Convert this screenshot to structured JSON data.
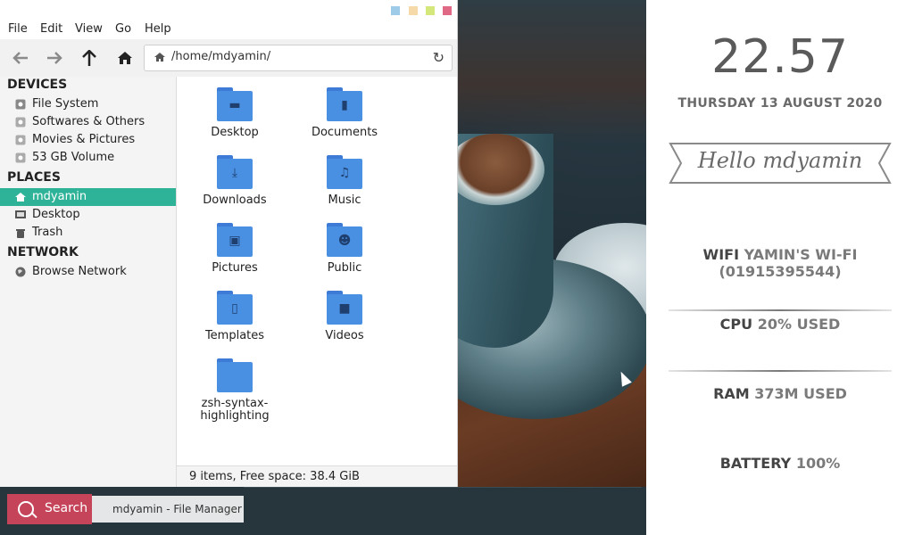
{
  "file_manager": {
    "title_buttons": [
      {
        "name": "minimize",
        "color": "#9ecbe8"
      },
      {
        "name": "maximize",
        "color": "#f5d9a8"
      },
      {
        "name": "shade",
        "color": "#d4e77a"
      },
      {
        "name": "close",
        "color": "#e06a86"
      }
    ],
    "menu": [
      "File",
      "Edit",
      "View",
      "Go",
      "Help"
    ],
    "toolbar": {
      "back_icon": "arrow-left-icon",
      "forward_icon": "arrow-right-icon",
      "up_icon": "arrow-up-icon",
      "home_icon": "home-icon",
      "address": "/home/mdyamin/"
    },
    "sidebar": {
      "devices_header": "DEVICES",
      "devices": [
        "File System",
        "Softwares & Others",
        "Movies & Pictures",
        "53 GB Volume"
      ],
      "places_header": "PLACES",
      "places": [
        "mdyamin",
        "Desktop",
        "Trash"
      ],
      "network_header": "NETWORK",
      "network": [
        "Browse Network"
      ]
    },
    "items": [
      {
        "name": "Desktop",
        "glyph": "▬"
      },
      {
        "name": "Documents",
        "glyph": "▮"
      },
      {
        "name": "Downloads",
        "glyph": "⤓"
      },
      {
        "name": "Music",
        "glyph": "♫"
      },
      {
        "name": "Pictures",
        "glyph": "▣"
      },
      {
        "name": "Public",
        "glyph": "☻"
      },
      {
        "name": "Templates",
        "glyph": "▯"
      },
      {
        "name": "Videos",
        "glyph": "■"
      },
      {
        "name": "zsh-syntax-highlighting",
        "glyph": ""
      }
    ],
    "status": "9 items, Free space: 38.4 GiB",
    "accent": "#2eb398"
  },
  "taskbar": {
    "search_label": "Search",
    "task_label": "mdyamin - File Manager",
    "search_color": "#c6445a"
  },
  "conky": {
    "time": "22.57",
    "date": "THURSDAY 13 AUGUST 2020",
    "greeting": "Hello mdyamin",
    "wifi_label": "WIFI",
    "wifi_value": "YAMIN'S WI-FI (01915395544)",
    "cpu_label": "CPU",
    "cpu_value": "20% USED",
    "ram_label": "RAM",
    "ram_value": "373M USED",
    "battery_label": "BATTERY",
    "battery_value": "100%"
  }
}
